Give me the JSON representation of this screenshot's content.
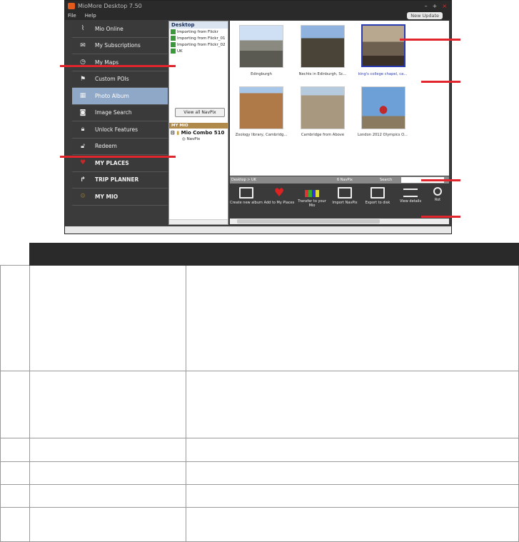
{
  "window": {
    "title": "MioMore Desktop 7.50",
    "controls": [
      "–",
      "+",
      "×"
    ],
    "menu": [
      "File",
      "Help"
    ],
    "new_update": "New Update"
  },
  "sidebar": {
    "items": [
      {
        "label": "Mio Online",
        "icon": "signal-icon"
      },
      {
        "label": "My Subscriptions",
        "icon": "envelope-icon"
      },
      {
        "label": "My Maps",
        "icon": "compass-icon"
      },
      {
        "label": "Custom POIs",
        "icon": "flag-icon"
      },
      {
        "label": "Photo Album",
        "icon": "photo-album-icon"
      },
      {
        "label": "Image Search",
        "icon": "camera-icon"
      },
      {
        "label": "Unlock Features",
        "icon": "lock-icon"
      },
      {
        "label": "Redeem",
        "icon": "unlock-icon"
      },
      {
        "label": "MY PLACES",
        "icon": "heart-icon"
      },
      {
        "label": "TRIP PLANNER",
        "icon": "route-icon"
      },
      {
        "label": "MY MIO",
        "icon": "gear-icon"
      }
    ]
  },
  "desktop_panel": {
    "heading": "Desktop",
    "items": [
      "Importing from Flickr",
      "Importing from Flickr_01",
      "Importing from Flickr_02",
      "UK"
    ],
    "view_all": "View all NavPix"
  },
  "mymio_panel": {
    "heading": "MY MIO",
    "device": "Mio Combo 510",
    "sub": "NavPix"
  },
  "photos": [
    {
      "caption": "Edingburgh"
    },
    {
      "caption": "Nechts in Edinburgh, Sc..."
    },
    {
      "caption": "king's college chapel, ca..."
    },
    {
      "caption": "Zoology library, Cambridg..."
    },
    {
      "caption": "Cambridge from Above"
    },
    {
      "caption": "London 2012 Olympics O..."
    }
  ],
  "statusbar": {
    "path": "Desktop > UK",
    "count": "6 NavPix",
    "search_label": "Search"
  },
  "toolbar": [
    {
      "label": "Create new album",
      "icon": "new-album-icon"
    },
    {
      "label": "Add to My Places",
      "icon": "heart-plus-icon"
    },
    {
      "label": "Transfer to your Mio",
      "icon": "transfer-icon"
    },
    {
      "label": "Import NavPix",
      "icon": "import-icon"
    },
    {
      "label": "Export to disk",
      "icon": "export-icon"
    },
    {
      "label": "View details",
      "icon": "list-icon"
    },
    {
      "label": "Rot",
      "icon": "rotate-icon"
    }
  ],
  "colors": {
    "callout": "#e0262c",
    "sidebar_active": "#8fa8c8",
    "table_header": "#2a2a2a"
  }
}
